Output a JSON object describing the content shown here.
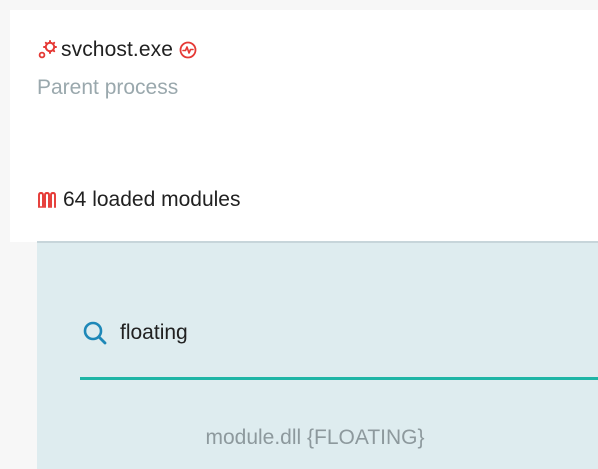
{
  "process": {
    "name": "svchost.exe",
    "parent_label": "Parent process",
    "icon": "gears-icon",
    "status_icon": "activity-badge-icon"
  },
  "modules": {
    "label": "64 loaded modules",
    "icon": "modules-icon"
  },
  "search": {
    "value": "floating",
    "icon": "search-icon"
  },
  "results": [
    {
      "label": "module.dll {FLOATING}"
    }
  ],
  "colors": {
    "accent_red": "#e53935",
    "teal_underline": "#1fb5a6",
    "search_icon": "#1e88b8",
    "panel_bg": "#deecef",
    "muted_text": "#9aa8ad"
  }
}
